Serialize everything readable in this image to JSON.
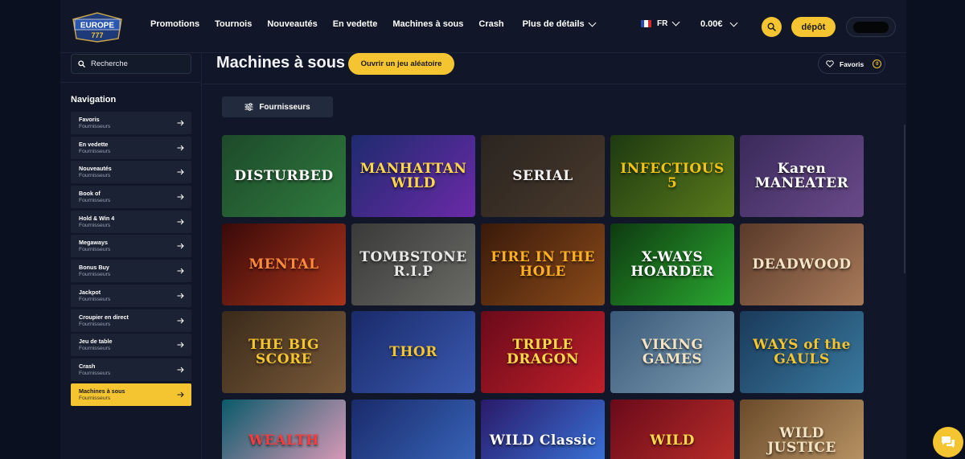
{
  "brand": {
    "logo_text": "EUROPE",
    "logo_sub": "777"
  },
  "nav": {
    "items": [
      "Promotions",
      "Tournois",
      "Nouveautés",
      "En vedette",
      "Machines à sous",
      "Crash"
    ],
    "more": "Plus de détails"
  },
  "header": {
    "lang": "FR",
    "balance": "0.00€",
    "deposit": "dépôt"
  },
  "sidebar": {
    "search_placeholder": "Recherche",
    "nav_title": "Navigation",
    "items": [
      {
        "title": "Favoris",
        "sub": "Fournisseurs"
      },
      {
        "title": "En vedette",
        "sub": "Fournisseurs"
      },
      {
        "title": "Nouveautés",
        "sub": "Fournisseurs"
      },
      {
        "title": "Book of",
        "sub": "Fournisseurs"
      },
      {
        "title": "Hold & Win 4",
        "sub": "Fournisseurs"
      },
      {
        "title": "Megaways",
        "sub": "Fournisseurs"
      },
      {
        "title": "Bonus Buy",
        "sub": "Fournisseurs"
      },
      {
        "title": "Jackpot",
        "sub": "Fournisseurs"
      },
      {
        "title": "Croupier en direct",
        "sub": "Fournisseurs"
      },
      {
        "title": "Jeu de table",
        "sub": "Fournisseurs"
      },
      {
        "title": "Crash",
        "sub": "Fournisseurs"
      },
      {
        "title": "Machines à sous",
        "sub": "Fournisseurs"
      }
    ],
    "active_index": 11
  },
  "main": {
    "title": "Machines à sous",
    "random_button": "Ouvrir un jeu aléatoire",
    "favorites_label": "Favoris",
    "favorites_count": "0",
    "providers_button": "Fournisseurs"
  },
  "games": [
    {
      "name": "DISTURBED",
      "bg": [
        "#1d4a2a",
        "#2f7a3e"
      ],
      "color": "#ffffff"
    },
    {
      "name": "MANHATTAN WILD",
      "bg": [
        "#1e2b6e",
        "#6b2aa8"
      ],
      "color": "#ffd84a"
    },
    {
      "name": "SERIAL",
      "bg": [
        "#2a2420",
        "#4a3a2c"
      ],
      "color": "#f4f4f4"
    },
    {
      "name": "INFECTIOUS 5",
      "bg": [
        "#1d3a10",
        "#5a7a1c"
      ],
      "color": "#f2c316"
    },
    {
      "name": "Karen MANEATER",
      "bg": [
        "#3a2a5a",
        "#6a4a8a"
      ],
      "color": "#ffffff"
    },
    {
      "name": "MENTAL",
      "bg": [
        "#3a0a08",
        "#a8341c"
      ],
      "color": "#ff8a3a"
    },
    {
      "name": "TOMBSTONE R.I.P",
      "bg": [
        "#3a3a3a",
        "#6a6a66"
      ],
      "color": "#e8e8e8"
    },
    {
      "name": "FIRE IN THE HOLE",
      "bg": [
        "#3a1a0a",
        "#8a4a1a"
      ],
      "color": "#ffb020"
    },
    {
      "name": "X-WAYS HOARDER",
      "bg": [
        "#0e3a10",
        "#2aa830"
      ],
      "color": "#ffffff"
    },
    {
      "name": "DEADWOOD",
      "bg": [
        "#5a3a2a",
        "#a87a5a"
      ],
      "color": "#f4e4c4"
    },
    {
      "name": "THE BIG SCORE",
      "bg": [
        "#3a2a1a",
        "#7a5a3a"
      ],
      "color": "#f4c431"
    },
    {
      "name": "THOR",
      "bg": [
        "#1a2a6a",
        "#3a5ab0"
      ],
      "color": "#f4c431"
    },
    {
      "name": "TRIPLE DRAGON",
      "bg": [
        "#6a0a1a",
        "#c0202a"
      ],
      "color": "#ffd84a"
    },
    {
      "name": "VIKING GAMES",
      "bg": [
        "#3a5a7a",
        "#7a9ab0"
      ],
      "color": "#f4e4c4"
    },
    {
      "name": "WAYS of the GAULS",
      "bg": [
        "#1a3a5a",
        "#3a7aa0"
      ],
      "color": "#f4c431"
    },
    {
      "name": "WEALTH",
      "bg": [
        "#0a5a6a",
        "#f0a0c0"
      ],
      "color": "#ff3a3a"
    },
    {
      "name": "",
      "bg": [
        "#1a2a6a",
        "#3a6ac0"
      ],
      "color": "#ffffff"
    },
    {
      "name": "WILD Classic",
      "bg": [
        "#2a1a6a",
        "#3a7ae0"
      ],
      "color": "#ffffff"
    },
    {
      "name": "WILD",
      "bg": [
        "#6a0a1a",
        "#c0302a"
      ],
      "color": "#ffd84a"
    },
    {
      "name": "WILD JUSTICE",
      "bg": [
        "#6a4a2a",
        "#c09a6a"
      ],
      "color": "#f4e4c4"
    }
  ]
}
